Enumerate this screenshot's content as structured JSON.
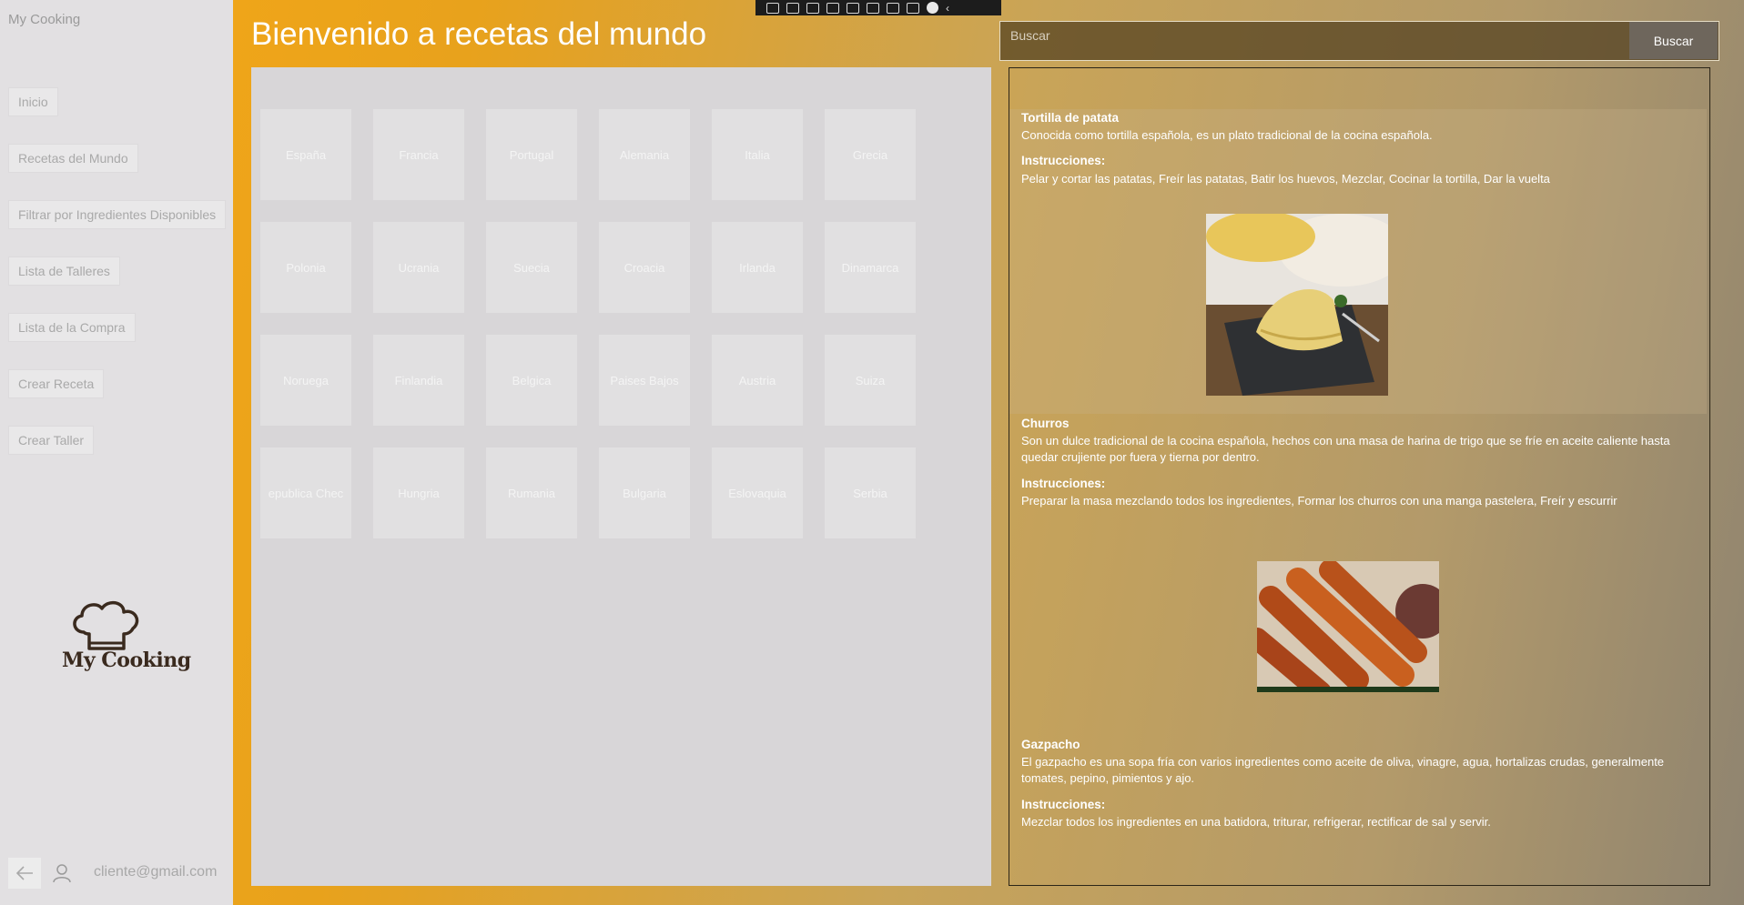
{
  "sidebar": {
    "app_title": "My Cooking",
    "items": [
      {
        "label": "Inicio"
      },
      {
        "label": "Recetas del Mundo"
      },
      {
        "label": "Filtrar por Ingredientes Disponibles"
      },
      {
        "label": "Lista de Talleres"
      },
      {
        "label": "Lista de la Compra"
      },
      {
        "label": "Crear Receta"
      },
      {
        "label": "Crear Taller"
      }
    ],
    "logo_text": "My Cooking",
    "user_email": "cliente@gmail.com"
  },
  "header": {
    "title": "Bienvenido a recetas del mundo"
  },
  "search": {
    "placeholder": "Buscar",
    "button_label": "Buscar"
  },
  "countries": [
    [
      "España",
      "Francia",
      "Portugal",
      "Alemania",
      "Italia",
      "Grecia"
    ],
    [
      "Polonia",
      "Ucrania",
      "Suecia",
      "Croacia",
      "Irlanda",
      "Dinamarca"
    ],
    [
      "Noruega",
      "Finlandia",
      "Belgica",
      "Paises Bajos",
      "Austria",
      "Suiza"
    ],
    [
      "epublica Chec",
      "Hungria",
      "Rumania",
      "Bulgaria",
      "Eslovaquia",
      "Serbia"
    ]
  ],
  "recipes": [
    {
      "title": "Tortilla de patata",
      "description": "Conocida como tortilla española, es un plato tradicional de la cocina española.",
      "instructions_label": "Instrucciones:",
      "instructions": "Pelar y cortar las patatas, Freír las patatas, Batir los huevos, Mezclar, Cocinar la tortilla, Dar la vuelta",
      "image_icon": "tortilla-image"
    },
    {
      "title": "Churros",
      "description": "Son un dulce tradicional de la cocina española, hechos con una masa de harina de trigo que se fríe en aceite caliente hasta quedar crujiente por fuera y tierna por dentro.",
      "instructions_label": "Instrucciones:",
      "instructions": "Preparar la masa mezclando todos los ingredientes, Formar los churros con una manga pastelera, Freír y escurrir",
      "image_icon": "churros-image"
    },
    {
      "title": "Gazpacho",
      "description": "El gazpacho es una sopa fría con varios ingredientes como aceite de oliva, vinagre, agua, hortalizas crudas, generalmente tomates, pepino, pimientos y ajo.",
      "instructions_label": "Instrucciones:",
      "instructions": "Mezclar todos los ingredientes en una batidora, triturar, refrigerar, rectificar de sal y servir."
    }
  ],
  "colors": {
    "accent": "#f6a816",
    "sidebar_bg": "#e2e0e2",
    "grid_bg": "#d8d6d8"
  }
}
